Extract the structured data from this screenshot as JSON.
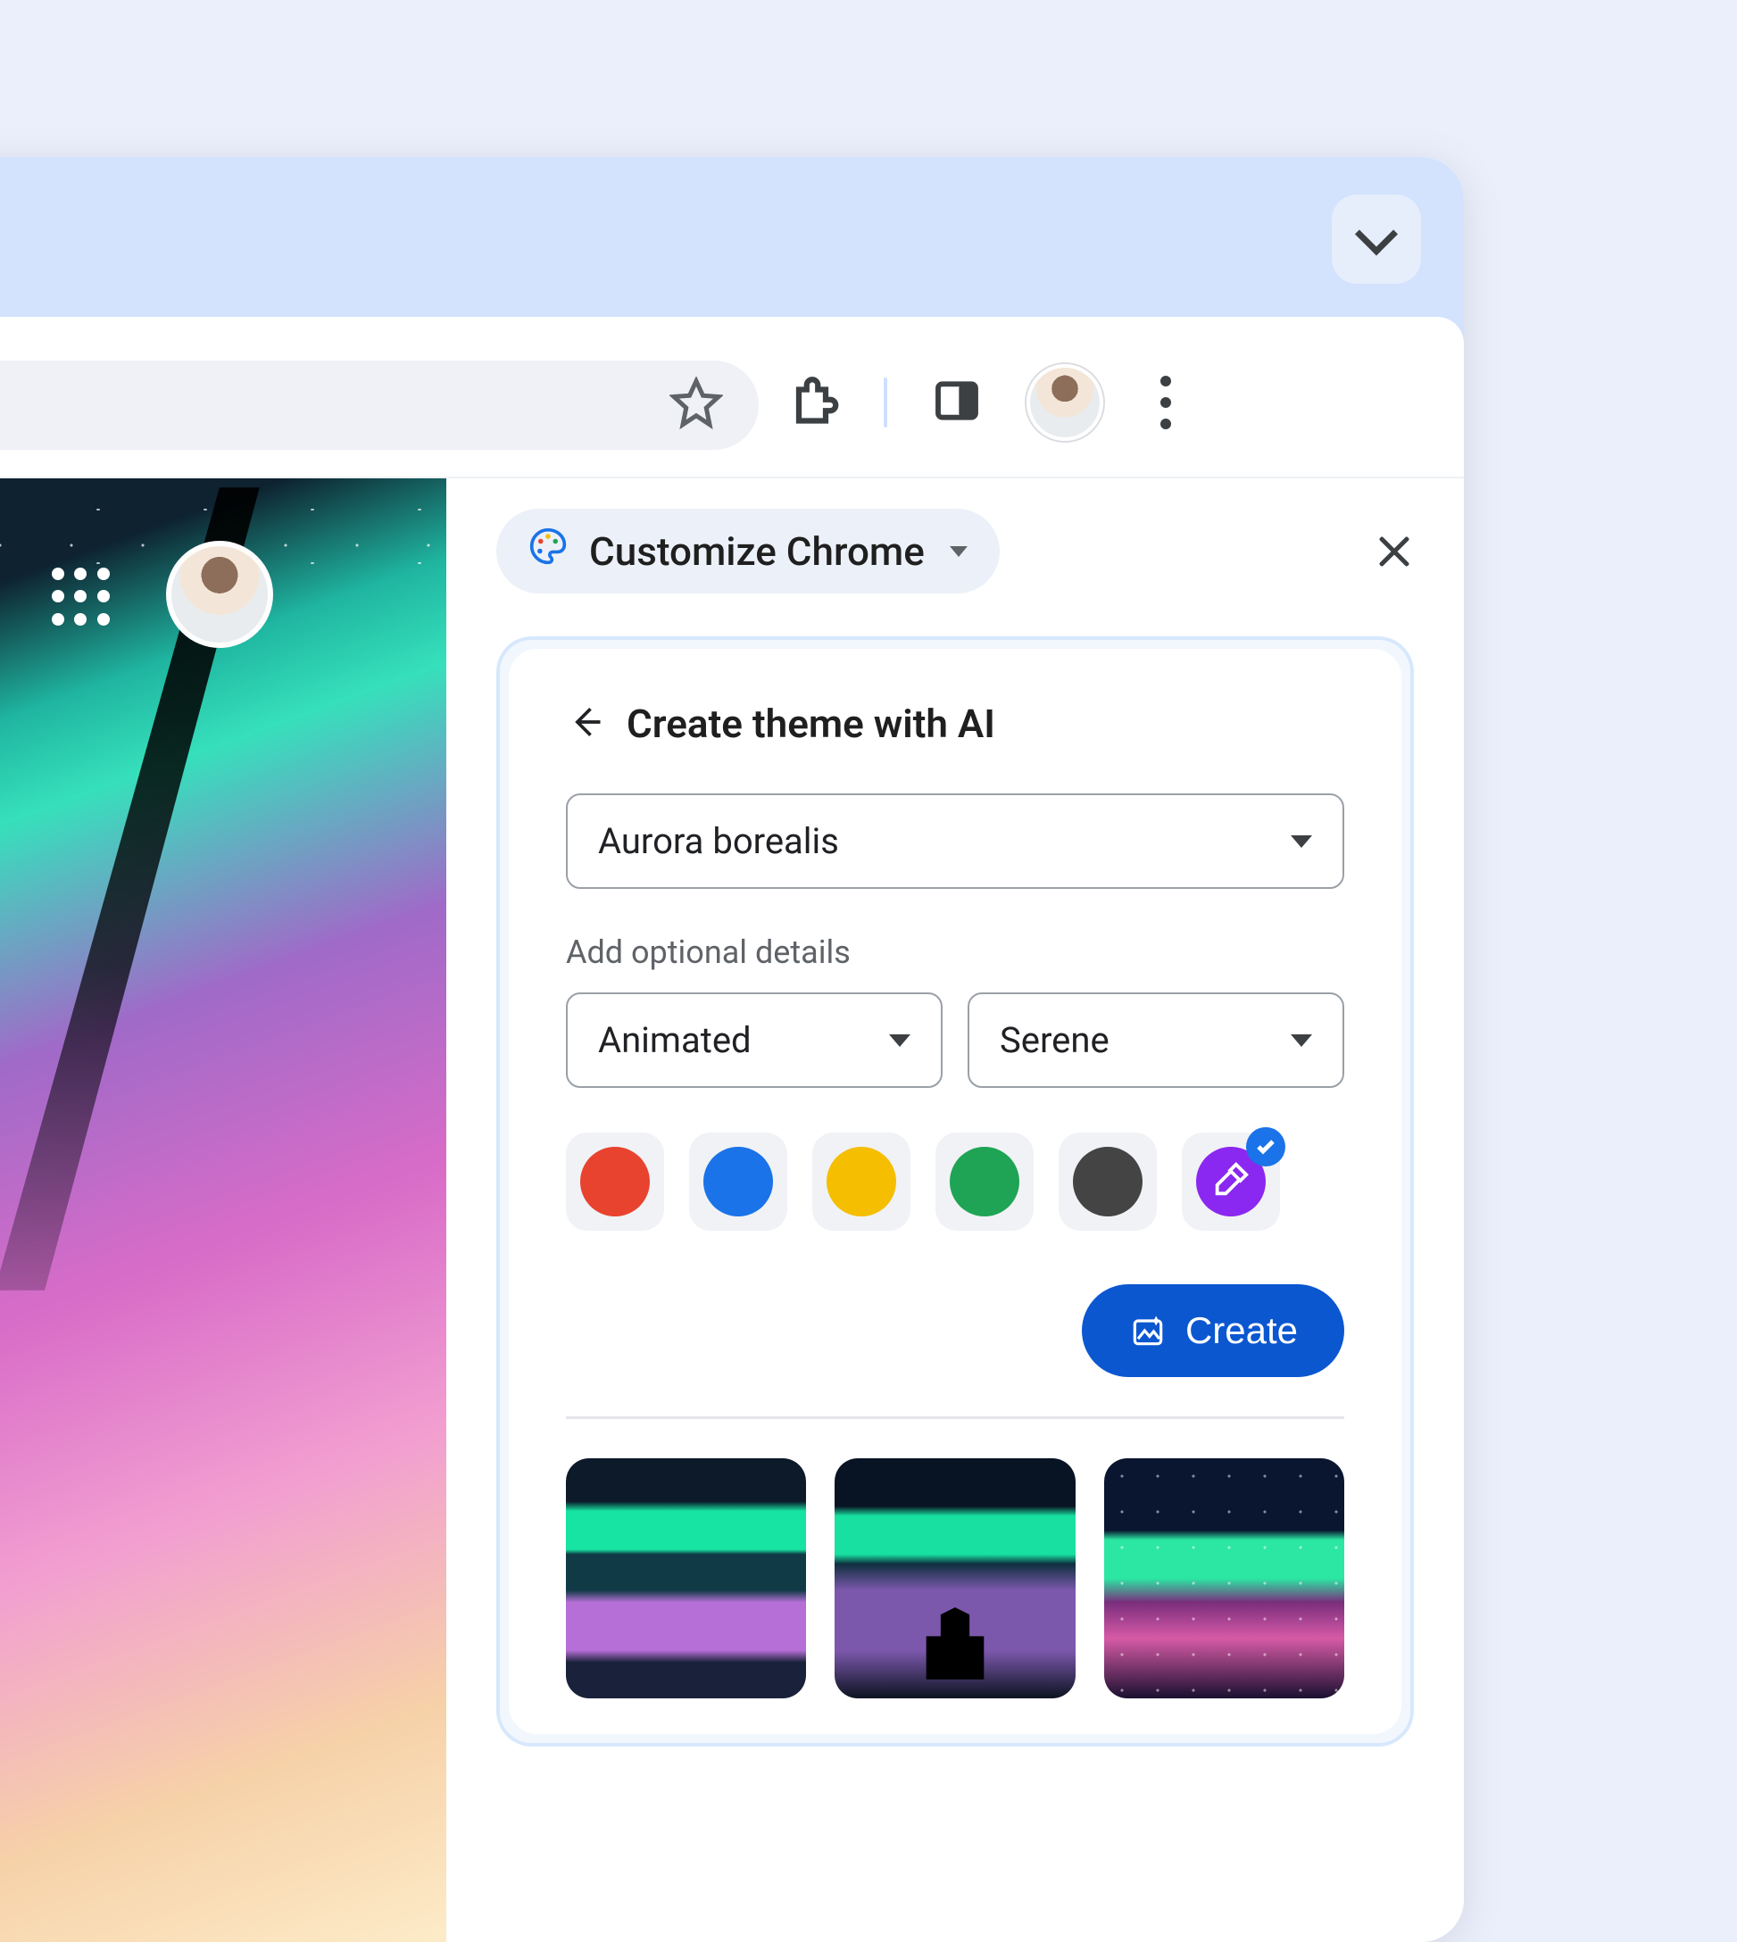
{
  "sidepanel": {
    "chip_label": "Customize Chrome",
    "card_title": "Create theme with AI",
    "subject": "Aurora borealis",
    "hint": "Add optional details",
    "style": "Animated",
    "mood": "Serene",
    "create_label": "Create",
    "colors": [
      {
        "name": "red",
        "hex": "#E8432E"
      },
      {
        "name": "blue",
        "hex": "#1A73E8"
      },
      {
        "name": "yellow",
        "hex": "#F5BE00"
      },
      {
        "name": "green",
        "hex": "#1EA454"
      },
      {
        "name": "grey",
        "hex": "#444444"
      }
    ],
    "custom_color_selected": true,
    "custom_color_bg": "#8A27F0"
  }
}
